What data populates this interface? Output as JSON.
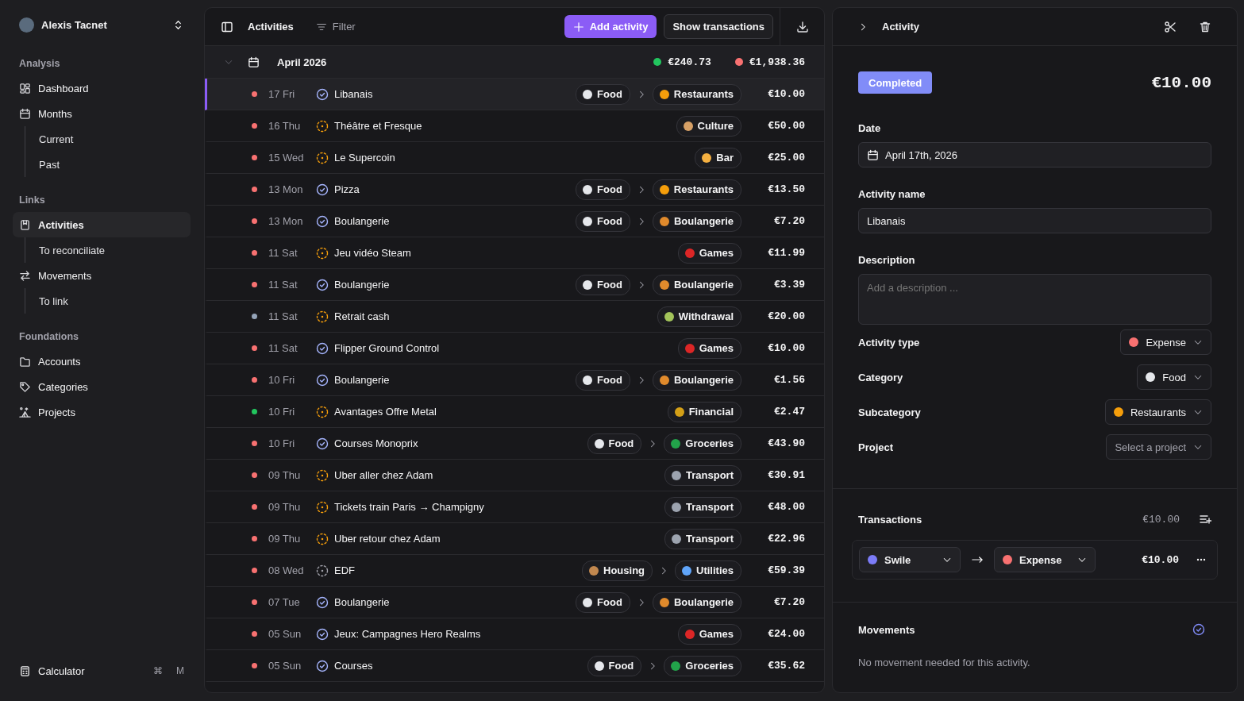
{
  "user": {
    "name": "Alexis Tacnet"
  },
  "sidebar": {
    "sections": [
      {
        "title": "Analysis",
        "items": [
          {
            "label": "Dashboard",
            "kind": "main",
            "selected": false
          },
          {
            "label": "Months",
            "kind": "main",
            "selected": false
          },
          {
            "label": "Current",
            "kind": "sub",
            "selected": false
          },
          {
            "label": "Past",
            "kind": "sub",
            "selected": false
          }
        ]
      },
      {
        "title": "Links",
        "items": [
          {
            "label": "Activities",
            "kind": "main",
            "selected": true
          },
          {
            "label": "To reconciliate",
            "kind": "sub",
            "selected": false
          },
          {
            "label": "Movements",
            "kind": "main",
            "selected": false
          },
          {
            "label": "To link",
            "kind": "sub",
            "selected": false
          }
        ]
      },
      {
        "title": "Foundations",
        "items": [
          {
            "label": "Accounts",
            "kind": "main",
            "selected": false
          },
          {
            "label": "Categories",
            "kind": "main",
            "selected": false
          },
          {
            "label": "Projects",
            "kind": "main",
            "selected": false
          }
        ]
      }
    ],
    "footer": {
      "label": "Calculator",
      "keys": [
        "⌘",
        "M"
      ]
    }
  },
  "toolbar": {
    "title": "Activities",
    "filter": "Filter",
    "add_button": "Add activity",
    "show_button": "Show transactions"
  },
  "month": {
    "title": "April 2026",
    "totals": [
      {
        "value": "€240.73",
        "color": "#22c55e"
      },
      {
        "value": "€1,938.36",
        "color": "#f87171"
      }
    ]
  },
  "rows": [
    {
      "date": "17 Fri",
      "kind": "reconciled",
      "name": "Libanais",
      "color": "#f87171",
      "tags": [
        {
          "label": "Food",
          "color": "#e5e7eb"
        },
        {
          "label": "Restaurants",
          "color": "#f59e0b"
        }
      ],
      "amount": "€10.00",
      "selected": true
    },
    {
      "date": "16 Thu",
      "kind": "pending",
      "name": "Théâtre et Fresque",
      "color": "#f87171",
      "tags": [
        {
          "label": "Culture",
          "color": "#d6a066"
        }
      ],
      "amount": "€50.00",
      "selected": false
    },
    {
      "date": "15 Wed",
      "kind": "pending",
      "name": "Le Supercoin",
      "color": "#f87171",
      "tags": [
        {
          "label": "Bar",
          "color": "#f5b041"
        }
      ],
      "amount": "€25.00",
      "selected": false
    },
    {
      "date": "13 Mon",
      "kind": "reconciled",
      "name": "Pizza",
      "color": "#f87171",
      "tags": [
        {
          "label": "Food",
          "color": "#e5e7eb"
        },
        {
          "label": "Restaurants",
          "color": "#f59e0b"
        }
      ],
      "amount": "€13.50",
      "selected": false
    },
    {
      "date": "13 Mon",
      "kind": "reconciled",
      "name": "Boulangerie",
      "color": "#f87171",
      "tags": [
        {
          "label": "Food",
          "color": "#e5e7eb"
        },
        {
          "label": "Boulangerie",
          "color": "#e08a2c"
        }
      ],
      "amount": "€7.20",
      "selected": false
    },
    {
      "date": "11 Sat",
      "kind": "pending",
      "name": "Jeu vidéo Steam",
      "color": "#f87171",
      "tags": [
        {
          "label": "Games",
          "color": "#dc2626"
        }
      ],
      "amount": "€11.99",
      "selected": false
    },
    {
      "date": "11 Sat",
      "kind": "reconciled",
      "name": "Boulangerie",
      "color": "#f87171",
      "tags": [
        {
          "label": "Food",
          "color": "#e5e7eb"
        },
        {
          "label": "Boulangerie",
          "color": "#e08a2c"
        }
      ],
      "amount": "€3.39",
      "selected": false
    },
    {
      "date": "11 Sat",
      "kind": "pending",
      "name": "Retrait cash",
      "color": "#94a3b8",
      "tags": [
        {
          "label": "Withdrawal",
          "color": "#a3c45a"
        }
      ],
      "amount": "€20.00",
      "selected": false
    },
    {
      "date": "11 Sat",
      "kind": "reconciled",
      "name": "Flipper Ground Control",
      "color": "#f87171",
      "tags": [
        {
          "label": "Games",
          "color": "#dc2626"
        }
      ],
      "amount": "€10.00",
      "selected": false
    },
    {
      "date": "10 Fri",
      "kind": "reconciled",
      "name": "Boulangerie",
      "color": "#f87171",
      "tags": [
        {
          "label": "Food",
          "color": "#e5e7eb"
        },
        {
          "label": "Boulangerie",
          "color": "#e08a2c"
        }
      ],
      "amount": "€1.56",
      "selected": false
    },
    {
      "date": "10 Fri",
      "kind": "pending",
      "name": "Avantages Offre Metal",
      "color": "#22c55e",
      "tags": [
        {
          "label": "Financial",
          "color": "#d4a017"
        }
      ],
      "amount": "€2.47",
      "selected": false
    },
    {
      "date": "10 Fri",
      "kind": "reconciled",
      "name": "Courses Monoprix",
      "color": "#f87171",
      "tags": [
        {
          "label": "Food",
          "color": "#e5e7eb"
        },
        {
          "label": "Groceries",
          "color": "#22a34a"
        }
      ],
      "amount": "€43.90",
      "selected": false
    },
    {
      "date": "09 Thu",
      "kind": "pending",
      "name": "Uber aller chez Adam",
      "color": "#f87171",
      "tags": [
        {
          "label": "Transport",
          "color": "#9ca3af"
        }
      ],
      "amount": "€30.91",
      "selected": false
    },
    {
      "date": "09 Thu",
      "kind": "pending",
      "name": "Tickets train Paris → Champigny",
      "color": "#f87171",
      "tags": [
        {
          "label": "Transport",
          "color": "#9ca3af"
        }
      ],
      "amount": "€48.00",
      "selected": false
    },
    {
      "date": "09 Thu",
      "kind": "pending",
      "name": "Uber retour chez Adam",
      "color": "#f87171",
      "tags": [
        {
          "label": "Transport",
          "color": "#9ca3af"
        }
      ],
      "amount": "€22.96",
      "selected": false
    },
    {
      "date": "08 Wed",
      "kind": "unlinked",
      "name": "EDF",
      "color": "#f87171",
      "tags": [
        {
          "label": "Housing",
          "color": "#c2884f"
        },
        {
          "label": "Utilities",
          "color": "#60a5fa"
        }
      ],
      "amount": "€59.39",
      "selected": false
    },
    {
      "date": "07 Tue",
      "kind": "reconciled",
      "name": "Boulangerie",
      "color": "#f87171",
      "tags": [
        {
          "label": "Food",
          "color": "#e5e7eb"
        },
        {
          "label": "Boulangerie",
          "color": "#e08a2c"
        }
      ],
      "amount": "€7.20",
      "selected": false
    },
    {
      "date": "05 Sun",
      "kind": "reconciled",
      "name": "Jeux: Campagnes Hero Realms",
      "color": "#f87171",
      "tags": [
        {
          "label": "Games",
          "color": "#dc2626"
        }
      ],
      "amount": "€24.00",
      "selected": false
    },
    {
      "date": "05 Sun",
      "kind": "reconciled",
      "name": "Courses",
      "color": "#f87171",
      "tags": [
        {
          "label": "Food",
          "color": "#e5e7eb"
        },
        {
          "label": "Groceries",
          "color": "#22a34a"
        }
      ],
      "amount": "€35.62",
      "selected": false
    }
  ],
  "detail": {
    "title": "Activity",
    "status": "Completed",
    "amount": "€10.00",
    "date": {
      "label": "Date",
      "value": "April 17th, 2026"
    },
    "name": {
      "label": "Activity name",
      "value": "Libanais"
    },
    "description": {
      "label": "Description",
      "placeholder": "Add a description ..."
    },
    "selects": [
      {
        "label": "Activity type",
        "value": "Expense",
        "color": "#f87171"
      },
      {
        "label": "Category",
        "value": "Food",
        "color": "#e5e7eb"
      },
      {
        "label": "Subcategory",
        "value": "Restaurants",
        "color": "#f59e0b"
      },
      {
        "label": "Project",
        "placeholder": "Select a project"
      }
    ],
    "transactions": {
      "title": "Transactions",
      "total": "€10.00",
      "items": [
        {
          "accounts": [
            {
              "name": "Swile",
              "color": "#7c7cf8"
            },
            {
              "name": "Expense",
              "color": "#f87171"
            }
          ],
          "amount": "€10.00"
        }
      ]
    },
    "movements": {
      "title": "Movements",
      "message": "No movement needed for this activity."
    }
  }
}
